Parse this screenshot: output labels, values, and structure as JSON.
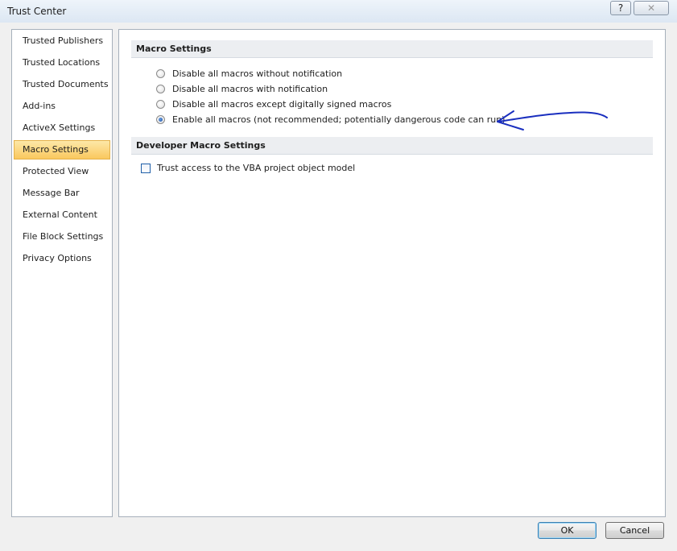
{
  "window": {
    "title": "Trust Center",
    "help_glyph": "?",
    "close_glyph": "✕"
  },
  "sidebar": {
    "items": [
      {
        "label": "Trusted Publishers",
        "selected": false
      },
      {
        "label": "Trusted Locations",
        "selected": false
      },
      {
        "label": "Trusted Documents",
        "selected": false
      },
      {
        "label": "Add-ins",
        "selected": false
      },
      {
        "label": "ActiveX Settings",
        "selected": false
      },
      {
        "label": "Macro Settings",
        "selected": true
      },
      {
        "label": "Protected View",
        "selected": false
      },
      {
        "label": "Message Bar",
        "selected": false
      },
      {
        "label": "External Content",
        "selected": false
      },
      {
        "label": "File Block Settings",
        "selected": false
      },
      {
        "label": "Privacy Options",
        "selected": false
      }
    ]
  },
  "macro_settings": {
    "header": "Macro Settings",
    "options": [
      {
        "label": "Disable all macros without notification",
        "checked": false
      },
      {
        "label": "Disable all macros with notification",
        "checked": false
      },
      {
        "label": "Disable all macros except digitally signed macros",
        "checked": false
      },
      {
        "label": "Enable all macros (not recommended; potentially dangerous code can run)",
        "checked": true
      }
    ]
  },
  "developer_settings": {
    "header": "Developer Macro Settings",
    "trust_vba_label": "Trust access to the VBA project object model",
    "trust_vba_checked": false
  },
  "buttons": {
    "ok": "OK",
    "cancel": "Cancel"
  },
  "colors": {
    "selected_nav": "#fac85e",
    "annotation_arrow": "#1a2fbf"
  }
}
